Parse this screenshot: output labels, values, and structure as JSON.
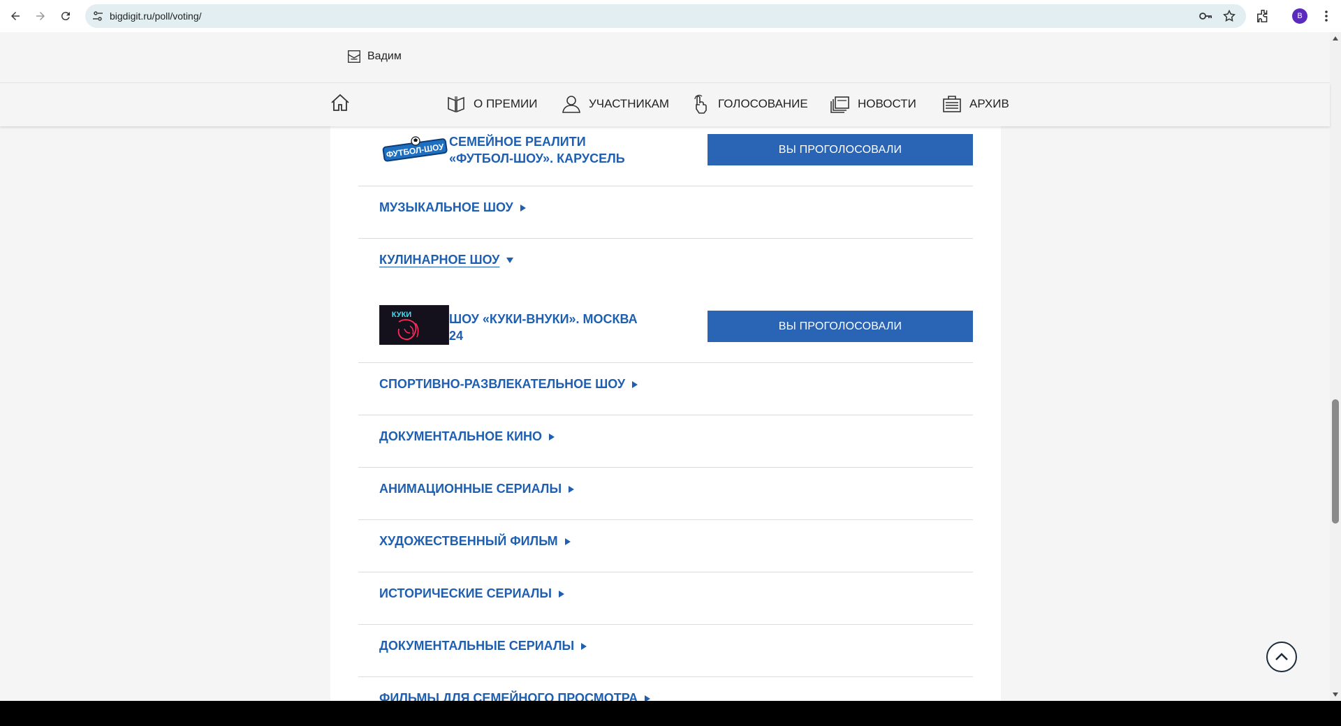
{
  "browser": {
    "url": "bigdigit.ru/poll/voting/",
    "profile_initial": "B"
  },
  "header": {
    "user_name": "Вадим",
    "nav": [
      {
        "label": "О ПРЕМИИ",
        "icon": "book-icon"
      },
      {
        "label": "УЧАСТНИКАМ",
        "icon": "person-icon"
      },
      {
        "label": "ГОЛОСОВАНИЕ",
        "icon": "hand-voting-icon"
      },
      {
        "label": "НОВОСТИ",
        "icon": "news-icon"
      },
      {
        "label": "АРХИВ",
        "icon": "archive-icon"
      }
    ]
  },
  "content": {
    "nominees": [
      {
        "title": "СЕМЕЙНОЕ РЕАЛИТИ «ФУТБОЛ-ШОУ». КАРУСЕЛЬ",
        "logo_text": "ФУТБОЛ-ШОУ",
        "button": "ВЫ ПРОГОЛОСОВАЛИ"
      },
      {
        "title": "ШОУ «КУКИ-ВНУКИ». МОСКВА 24",
        "logo_text": "КУКИ",
        "button": "ВЫ ПРОГОЛОСОВАЛИ"
      }
    ],
    "categories": [
      {
        "label": "МУЗЫКАЛЬНОЕ ШОУ",
        "expanded": false
      },
      {
        "label": "КУЛИНАРНОЕ ШОУ",
        "expanded": true
      },
      {
        "label": "СПОРТИВНО-РАЗВЛЕКАТЕЛЬНОЕ ШОУ",
        "expanded": false
      },
      {
        "label": "ДОКУМЕНТАЛЬНОЕ КИНО",
        "expanded": false
      },
      {
        "label": "АНИМАЦИОННЫЕ СЕРИАЛЫ",
        "expanded": false
      },
      {
        "label": "ХУДОЖЕСТВЕННЫЙ ФИЛЬМ",
        "expanded": false
      },
      {
        "label": "ИСТОРИЧЕСКИЕ СЕРИАЛЫ",
        "expanded": false
      },
      {
        "label": "ДОКУМЕНТАЛЬНЫЕ СЕРИАЛЫ",
        "expanded": false
      },
      {
        "label": "ФИЛЬМЫ ДЛЯ СЕМЕЙНОГО ПРОСМОТРА",
        "expanded": false
      }
    ]
  },
  "colors": {
    "accent": "#2a64b5",
    "link": "#1f5fb0"
  }
}
